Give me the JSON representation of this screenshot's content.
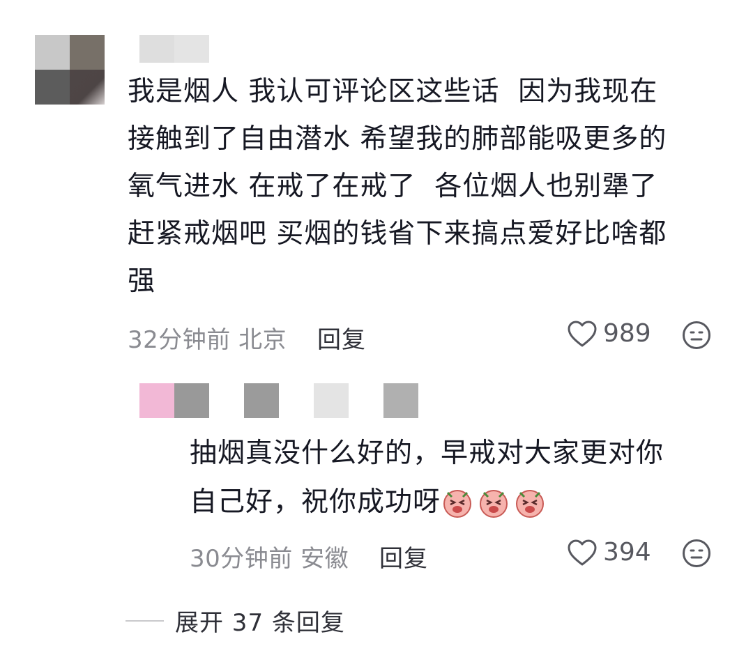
{
  "comment": {
    "text_lines": [
      "我是烟人 我认可评论区这些话  因为我现在",
      "接触到了自由潜水 希望我的肺部能吸更多的",
      "氧气进水 在戒了在戒了  各位烟人也别犟了",
      "赶紧戒烟吧 买烟的钱省下来搞点爱好比啥都",
      "强"
    ],
    "time_location": "32分钟前 北京",
    "reply_label": "回复",
    "like_count": "989",
    "like_icon": "heart-outline-icon",
    "more_icon": "neutral-face-icon"
  },
  "reply": {
    "text_lines": [
      "抽烟真没什么好的，早戒对大家更对你",
      "自己好，祝你成功呀"
    ],
    "emoji_icon": "crying-pig-emoji-icon",
    "time_location": "30分钟前 安徽",
    "reply_label": "回复",
    "like_count": "394"
  },
  "expand": {
    "label": "展开 37 条回复"
  },
  "colors": {
    "text": "#161823",
    "meta": "#8a8b91",
    "icon": "#57585f",
    "divider": "#c9c9cc"
  }
}
